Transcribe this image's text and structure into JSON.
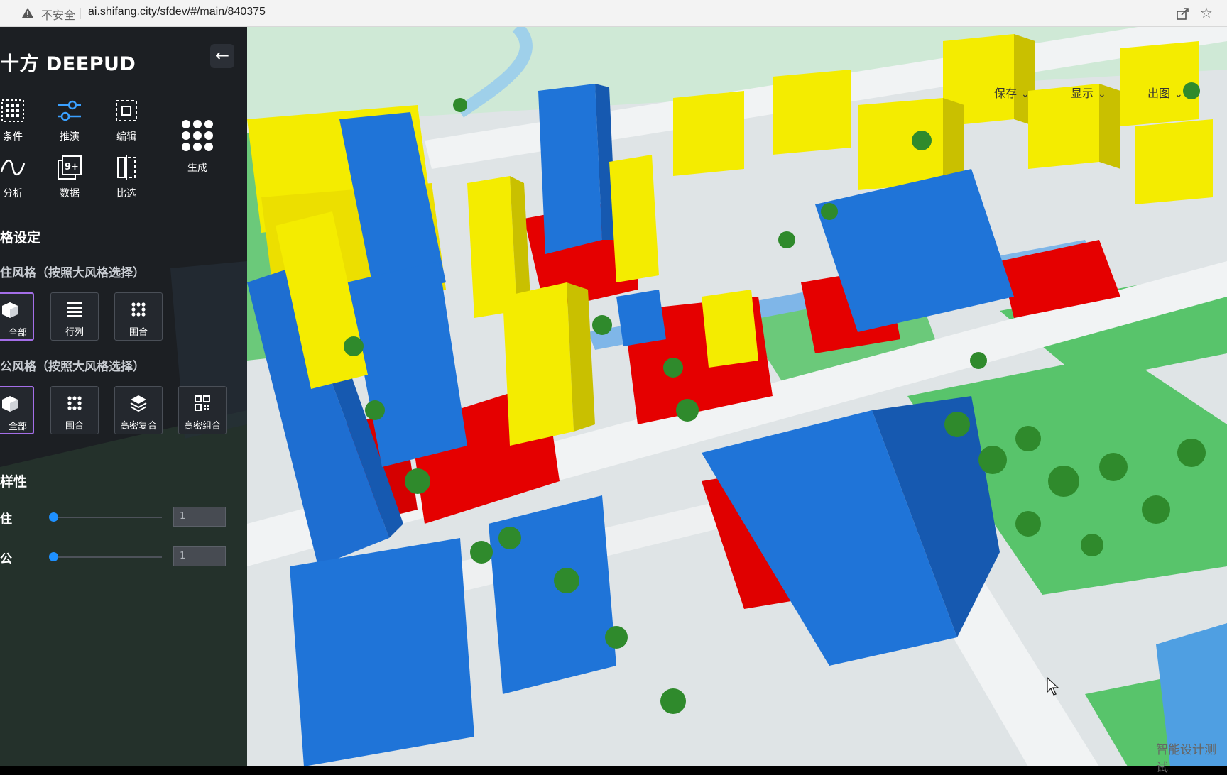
{
  "browser": {
    "insecure_label": "不安全",
    "separator": "|",
    "url": "ai.shifang.city/sfdev/#/main/840375"
  },
  "sidebar": {
    "brand": "十方 DEEPUD",
    "tools": [
      {
        "label": "条件",
        "icon": "grid-icon"
      },
      {
        "label": "推演",
        "icon": "sliders-icon"
      },
      {
        "label": "编辑",
        "icon": "edit-select-icon"
      },
      {
        "label": "分析",
        "icon": "wave-icon"
      },
      {
        "label": "数据",
        "icon": "data-9plus-icon"
      },
      {
        "label": "比选",
        "icon": "compare-icon"
      }
    ],
    "generate_label": "生成",
    "section_style": "格设定",
    "residential_style_title": "住风格（按照大风格选择）",
    "residential_options": [
      {
        "label": "全部",
        "icon": "cube-icon",
        "selected": true
      },
      {
        "label": "行列",
        "icon": "rows-icon",
        "selected": false
      },
      {
        "label": "围合",
        "icon": "dots-icon",
        "selected": false
      }
    ],
    "office_style_title": "公风格（按照大风格选择）",
    "office_options": [
      {
        "label": "全部",
        "icon": "cube-icon",
        "selected": true
      },
      {
        "label": "围合",
        "icon": "dots-icon",
        "selected": false
      },
      {
        "label": "高密复合",
        "icon": "layers-icon",
        "selected": false
      },
      {
        "label": "高密组合",
        "icon": "blocks-icon",
        "selected": false
      }
    ],
    "section_diversity": "样性",
    "sliders": [
      {
        "label": "住",
        "value": "1"
      },
      {
        "label": "公",
        "value": "1"
      }
    ]
  },
  "map": {
    "toolbar": {
      "save": "保存",
      "display": "显示",
      "export": "出图"
    },
    "watermark": "智能设计测试",
    "colors": {
      "residential": "#f0ea00",
      "office": "#1f6fd6",
      "podium": "#e00000",
      "tree": "#2f8a2c",
      "road": "#eef0f1",
      "green": "#55c46a",
      "water": "#5aa5e6"
    }
  }
}
